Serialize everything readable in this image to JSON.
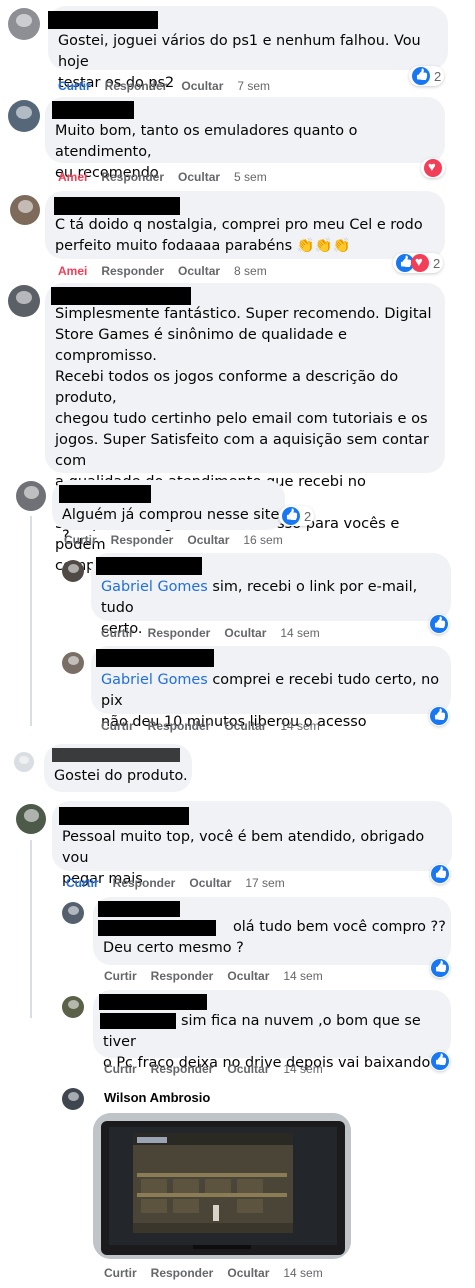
{
  "labels": {
    "like": "Curtir",
    "reply": "Responder",
    "hide": "Ocultar",
    "loved": "Amei"
  },
  "colors": {
    "link": "#216fdb",
    "love": "#f33e58",
    "like": "#1877f2",
    "meta": "#65676b",
    "bubble": "#f0f2f5"
  },
  "comments": [
    {
      "text": "Gostei, joguei vários do ps1 e nenhum falhou. Vou hoje\ntestar os do ps2",
      "time": "7 sem",
      "reaction": "like",
      "count": "2",
      "liked": true
    },
    {
      "text": "Muito bom, tanto os emuladores quanto o atendimento,\neu recomendo",
      "time": "5 sem",
      "reaction": "love",
      "action": "Amei"
    },
    {
      "text": "C tá doido q nostalgia, comprei pro meu Cel e rodo\nperfeito muito fodaaaa parabéns 👏👏👏",
      "time": "8 sem",
      "reaction": "like-love",
      "count": "2",
      "action": "Amei"
    },
    {
      "text": "Simplesmente fantástico. Super recomendo. Digital\nStore Games é sinônimo de qualidade e compromisso.\nRecebi todos os jogos conforme a descrição do produto,\nchegou tudo certinho pelo email com tutoriais e os\njogos. Super Satisfeito com a aquisição sem contar com\na qualidade do atendimento que recebi no whatsapp.\nSem palavras, gratidão e sucesso para vocês e podem\ncomprar sem medo de ser feliz 😊 😊 😊 😊"
    },
    {
      "text": "Alguém já comprou nesse site ?",
      "time": "16 sem",
      "reaction": "like",
      "count": "2"
    },
    {
      "mention": "Gabriel Gomes",
      "text": " sim, recebi o link por e-mail, tudo\ncerto.",
      "time": "14 sem",
      "reaction": "like"
    },
    {
      "mention": "Gabriel Gomes",
      "text": " comprei e recebi tudo certo, no pix\nnão deu 10 minutos liberou o acesso",
      "time": "14 sem",
      "reaction": "like"
    },
    {
      "text": "Gostei do produto."
    },
    {
      "text": "Pessoal muito top, você é bem atendido, obrigado vou\npegar mais",
      "time": "17 sem",
      "reaction": "like",
      "liked": true
    },
    {
      "text": "olá tudo bem você compro ??\nDeu certo mesmo ?",
      "time": "14 sem",
      "reaction": "like"
    },
    {
      "text": "sim fica na nuvem ,o bom que se tiver\no Pc fraco deixa no drive depois vai baixando",
      "time": "14 sem",
      "reaction": "like"
    },
    {
      "name": "Wilson Ambrosio",
      "time": "14 sem"
    }
  ]
}
